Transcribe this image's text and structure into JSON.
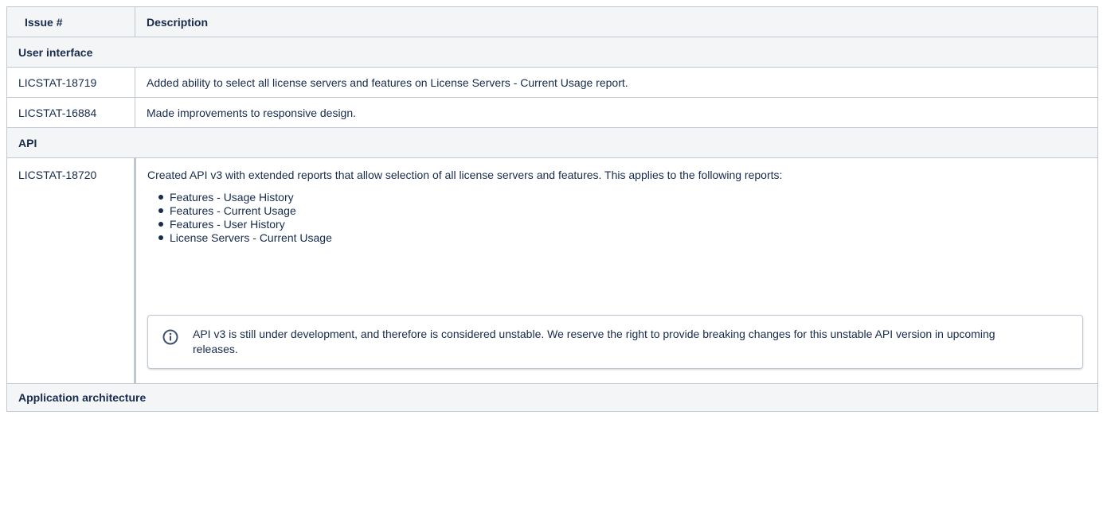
{
  "table": {
    "headers": {
      "issue": "Issue #",
      "description": "Description"
    },
    "sections": {
      "ui": "User interface",
      "api": "API",
      "architecture": "Application architecture"
    },
    "ui_rows": [
      {
        "id": "LICSTAT-18719",
        "description": "Added ability to select all license servers and features on License Servers - Current Usage report."
      },
      {
        "id": "LICSTAT-16884",
        "description": "Made improvements to responsive design."
      }
    ],
    "api_row": {
      "id": "LICSTAT-18720",
      "description": "Created API v3 with extended reports that allow selection of all license servers and features. This applies to the following reports:",
      "reports": [
        "Features - Usage History",
        "Features - Current Usage",
        "Features - User History",
        "License Servers - Current Usage"
      ],
      "note": "API v3 is still under development, and therefore is considered unstable. We reserve the right to provide breaking changes for this unstable API version in upcoming releases."
    }
  },
  "icons": {
    "note_icon": "info-icon",
    "note_icon_color": "#42526e"
  },
  "colors": {
    "header_bg": "#f4f5f7",
    "border": "#c1c7d0",
    "text": "#172b4d"
  }
}
